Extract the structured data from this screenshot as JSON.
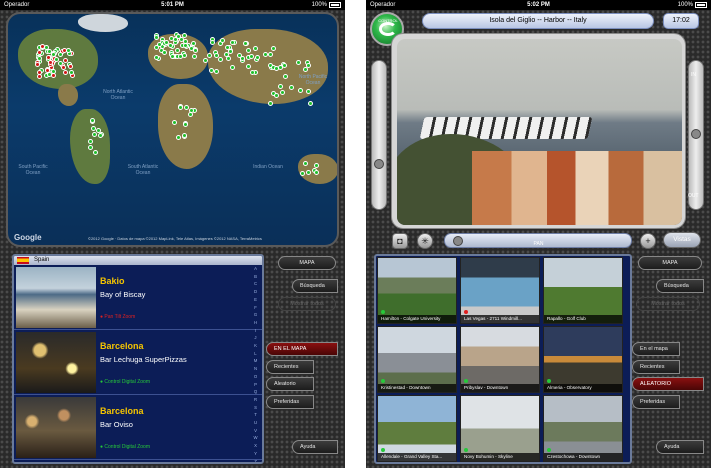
{
  "left": {
    "status": {
      "carrier": "Operador",
      "time": "5:01 PM",
      "battery": "100%"
    },
    "map": {
      "ocean_labels": [
        "North Pacific Ocean",
        "North Atlantic Ocean",
        "South Atlantic Ocean",
        "Indian Ocean",
        "South Pacific Ocean"
      ],
      "google": "Google",
      "copyright": "©2012 Google · Datos de mapa ©2012 MapLink, Tele Atlas, Imágenes ©2012 NASA, TerraMetrics"
    },
    "list": {
      "country": "Spain",
      "entries": [
        {
          "city": "Bakio",
          "place": "Bay of Biscay",
          "caption": "● Pan Tilt Zoom"
        },
        {
          "city": "Barcelona",
          "place": "Bar Lechuga SuperPizzas",
          "caption": "● Control Digital Zoom"
        },
        {
          "city": "Barcelona",
          "place": "Bar Oviso",
          "caption": "● Control Digital Zoom"
        }
      ],
      "alphabet": [
        "A",
        "B",
        "C",
        "D",
        "E",
        "F",
        "G",
        "H",
        "I",
        "J",
        "K",
        "L",
        "M",
        "N",
        "O",
        "P",
        "Q",
        "R",
        "S",
        "T",
        "U",
        "V",
        "W",
        "X",
        "Y",
        "Z"
      ]
    },
    "buttons": {
      "mapa": "MAPA",
      "busqueda": "Búsqueda",
      "mostrar_todos": "Mostrar todos",
      "en_el_mapa": "EN EL MAPA",
      "recientes": "Recientes",
      "aleatorio": "Aleatorio",
      "preferidas": "Preferidas",
      "ayuda": "Ayuda"
    }
  },
  "right": {
    "status": {
      "carrier": "Operador",
      "time": "5:02 PM",
      "battery": "100%"
    },
    "logo": "CONTROL",
    "title": "Isola del Giglio -- Harbor -- Italy",
    "clock": "17:02",
    "zoom": {
      "in": "IN",
      "out": "OUT"
    },
    "pan_label": "PAN",
    "vistas": "Vistas",
    "cameras": [
      {
        "caption": "Hamilton - Colgate University",
        "dot": "green"
      },
      {
        "caption": "Las Vegas - 2711 Windmill...",
        "dot": "red"
      },
      {
        "caption": "Rapallo - Golf Club",
        "dot": "none"
      },
      {
        "caption": "Kristinestad - Downtown",
        "dot": "green"
      },
      {
        "caption": "Pribyslav - Downtown",
        "dot": "green"
      },
      {
        "caption": "Almeria - Observatory",
        "dot": "green"
      },
      {
        "caption": "Allendale - Grand Valley Sta...",
        "dot": "green"
      },
      {
        "caption": "Novy Bohumin - Skyline",
        "dot": "green"
      },
      {
        "caption": "Czestochowa - Downtown",
        "dot": "green"
      }
    ],
    "buttons": {
      "mapa": "MAPA",
      "busqueda": "Búsqueda",
      "mostrar_todos": "Mostrar todos",
      "en_el_mapa": "En el mapa",
      "recientes": "Recientes",
      "aleatorio": "ALEATORIO",
      "preferidas": "Preferidas",
      "ayuda": "Ayuda"
    }
  }
}
